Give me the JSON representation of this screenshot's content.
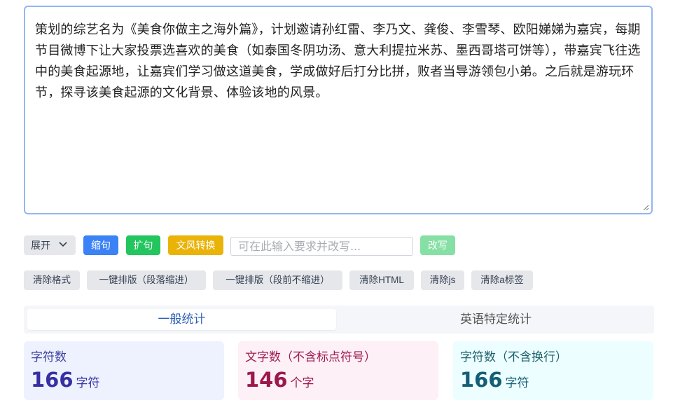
{
  "editor": {
    "text": "策划的综艺名为《美食你做主之海外篇》，计划邀请孙红雷、李乃文、龚俊、李雪琴、欧阳娣娣为嘉宾，每期节目微博下让大家投票选喜欢的美食（如泰国冬阴功汤、意大利提拉米苏、墨西哥塔可饼等），带嘉宾飞往选中的美食起源地，让嘉宾们学习做这道美食，学成做好后打分比拼，败者当导游领包小弟。之后就是游玩环节，探寻该美食起源的文化背景、体验该地的风景。"
  },
  "toolbar": {
    "expand_label": "展开",
    "shrink_label": "缩句",
    "expand_sentence_label": "扩句",
    "style_convert_label": "文风转换",
    "prompt_placeholder": "可在此输入要求并改写...",
    "rewrite_label": "改写"
  },
  "format_tools": {
    "clear_format": "清除格式",
    "layout_indent": "一键排版（段落缩进）",
    "layout_no_indent": "一键排版（段前不缩进）",
    "clear_html": "清除HTML",
    "clear_js": "清除js",
    "clear_a_tags": "清除a标签"
  },
  "tabs": {
    "general": "一般统计",
    "english": "英语特定统计"
  },
  "stats": {
    "chars": {
      "title": "字符数",
      "value": "166",
      "unit": "字符"
    },
    "words_no_punct": {
      "title": "文字数（不含标点符号）",
      "value": "146",
      "unit": "个字"
    },
    "chars_no_newline": {
      "title": "字符数（不含换行）",
      "value": "166",
      "unit": "字符"
    }
  },
  "colors": {
    "blue_button": "#3b82f6",
    "green_button": "#22c55e",
    "yellow_button": "#eab308",
    "rewrite_disabled": "#86e0a5",
    "editor_border": "#93b6f2"
  },
  "icons": {
    "expand_chevron": "chevron-down-icon",
    "resize": "resize-handle-icon"
  }
}
